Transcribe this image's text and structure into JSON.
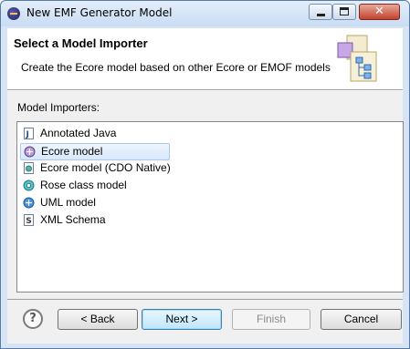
{
  "window": {
    "title": "New EMF Generator Model"
  },
  "banner": {
    "title": "Select a Model Importer",
    "description": "Create the Ecore model based on other Ecore or EMOF models"
  },
  "importers": {
    "label": "Model Importers:",
    "items": [
      {
        "label": "Annotated Java",
        "icon": "java-file-icon",
        "selected": false
      },
      {
        "label": "Ecore model",
        "icon": "ecore-icon",
        "selected": true
      },
      {
        "label": "Ecore model (CDO Native)",
        "icon": "cdo-icon",
        "selected": false
      },
      {
        "label": "Rose class model",
        "icon": "rose-icon",
        "selected": false
      },
      {
        "label": "UML model",
        "icon": "uml-icon",
        "selected": false
      },
      {
        "label": "XML Schema",
        "icon": "xsd-icon",
        "selected": false
      }
    ]
  },
  "buttons": {
    "help": "?",
    "back": "< Back",
    "next": "Next >",
    "finish": "Finish",
    "cancel": "Cancel"
  },
  "colors": {
    "selection": "#d9e8fb",
    "accent": "#3c7fb1"
  }
}
